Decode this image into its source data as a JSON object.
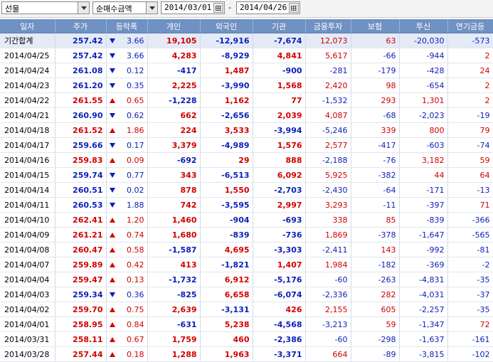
{
  "toolbar": {
    "market_select": "선물",
    "metric_select": "순매수금액",
    "start_date": "2014/03/01",
    "end_date": "2014/04/26",
    "range_separator": "-"
  },
  "columns": [
    "일자",
    "주가",
    "등락폭",
    "개인",
    "외국인",
    "기관",
    "금융투자",
    "보험",
    "투신",
    "연기금등"
  ],
  "rows": [
    {
      "date": "기간합계",
      "price": "257.42",
      "dir": "down",
      "change": "3.66",
      "indiv": "19,105",
      "foreign": "-12,916",
      "inst": "-7,674",
      "fin": "12,073",
      "ins": "63",
      "trust": "-20,030",
      "pension": "-573",
      "total": true
    },
    {
      "date": "2014/04/25",
      "price": "257.42",
      "dir": "down",
      "change": "3.66",
      "indiv": "4,283",
      "foreign": "-8,929",
      "inst": "4,841",
      "fin": "5,617",
      "ins": "-66",
      "trust": "-944",
      "pension": "2"
    },
    {
      "date": "2014/04/24",
      "price": "261.08",
      "dir": "down",
      "change": "0.12",
      "indiv": "-417",
      "foreign": "1,487",
      "inst": "-900",
      "fin": "-281",
      "ins": "-179",
      "trust": "-428",
      "pension": "24"
    },
    {
      "date": "2014/04/23",
      "price": "261.20",
      "dir": "down",
      "change": "0.35",
      "indiv": "2,225",
      "foreign": "-3,990",
      "inst": "1,568",
      "fin": "2,420",
      "ins": "98",
      "trust": "-654",
      "pension": "2"
    },
    {
      "date": "2014/04/22",
      "price": "261.55",
      "dir": "up",
      "change": "0.65",
      "indiv": "-1,228",
      "foreign": "1,162",
      "inst": "77",
      "fin": "-1,532",
      "ins": "293",
      "trust": "1,301",
      "pension": "2"
    },
    {
      "date": "2014/04/21",
      "price": "260.90",
      "dir": "down",
      "change": "0.62",
      "indiv": "662",
      "foreign": "-2,656",
      "inst": "2,039",
      "fin": "4,087",
      "ins": "-68",
      "trust": "-2,023",
      "pension": "-19"
    },
    {
      "date": "2014/04/18",
      "price": "261.52",
      "dir": "up",
      "change": "1.86",
      "indiv": "224",
      "foreign": "3,533",
      "inst": "-3,994",
      "fin": "-5,246",
      "ins": "339",
      "trust": "800",
      "pension": "79"
    },
    {
      "date": "2014/04/17",
      "price": "259.66",
      "dir": "down",
      "change": "0.17",
      "indiv": "3,379",
      "foreign": "-4,989",
      "inst": "1,576",
      "fin": "2,577",
      "ins": "-417",
      "trust": "-603",
      "pension": "-74"
    },
    {
      "date": "2014/04/16",
      "price": "259.83",
      "dir": "up",
      "change": "0.09",
      "indiv": "-692",
      "foreign": "29",
      "inst": "888",
      "fin": "-2,188",
      "ins": "-76",
      "trust": "3,182",
      "pension": "59"
    },
    {
      "date": "2014/04/15",
      "price": "259.74",
      "dir": "down",
      "change": "0.77",
      "indiv": "343",
      "foreign": "-6,513",
      "inst": "6,092",
      "fin": "5,925",
      "ins": "-382",
      "trust": "44",
      "pension": "64"
    },
    {
      "date": "2014/04/14",
      "price": "260.51",
      "dir": "down",
      "change": "0.02",
      "indiv": "878",
      "foreign": "1,550",
      "inst": "-2,703",
      "fin": "-2,430",
      "ins": "-64",
      "trust": "-171",
      "pension": "-13"
    },
    {
      "date": "2014/04/11",
      "price": "260.53",
      "dir": "down",
      "change": "1.88",
      "indiv": "742",
      "foreign": "-3,595",
      "inst": "2,997",
      "fin": "3,293",
      "ins": "-11",
      "trust": "-397",
      "pension": "71"
    },
    {
      "date": "2014/04/10",
      "price": "262.41",
      "dir": "up",
      "change": "1.20",
      "indiv": "1,460",
      "foreign": "-904",
      "inst": "-693",
      "fin": "338",
      "ins": "85",
      "trust": "-839",
      "pension": "-366"
    },
    {
      "date": "2014/04/09",
      "price": "261.21",
      "dir": "up",
      "change": "0.74",
      "indiv": "1,680",
      "foreign": "-839",
      "inst": "-736",
      "fin": "1,869",
      "ins": "-378",
      "trust": "-1,647",
      "pension": "-565"
    },
    {
      "date": "2014/04/08",
      "price": "260.47",
      "dir": "up",
      "change": "0.58",
      "indiv": "-1,587",
      "foreign": "4,695",
      "inst": "-3,303",
      "fin": "-2,411",
      "ins": "143",
      "trust": "-992",
      "pension": "-81"
    },
    {
      "date": "2014/04/07",
      "price": "259.89",
      "dir": "up",
      "change": "0.42",
      "indiv": "413",
      "foreign": "-1,821",
      "inst": "1,407",
      "fin": "1,984",
      "ins": "-182",
      "trust": "-369",
      "pension": "-2"
    },
    {
      "date": "2014/04/04",
      "price": "259.47",
      "dir": "up",
      "change": "0.13",
      "indiv": "-1,732",
      "foreign": "6,912",
      "inst": "-5,176",
      "fin": "-60",
      "ins": "-263",
      "trust": "-4,831",
      "pension": "-35"
    },
    {
      "date": "2014/04/03",
      "price": "259.34",
      "dir": "down",
      "change": "0.36",
      "indiv": "-825",
      "foreign": "6,658",
      "inst": "-6,074",
      "fin": "-2,336",
      "ins": "282",
      "trust": "-4,031",
      "pension": "-37"
    },
    {
      "date": "2014/04/02",
      "price": "259.70",
      "dir": "up",
      "change": "0.75",
      "indiv": "2,639",
      "foreign": "-3,131",
      "inst": "426",
      "fin": "2,155",
      "ins": "605",
      "trust": "-2,257",
      "pension": "-35"
    },
    {
      "date": "2014/04/01",
      "price": "258.95",
      "dir": "up",
      "change": "0.84",
      "indiv": "-631",
      "foreign": "5,238",
      "inst": "-4,568",
      "fin": "-3,213",
      "ins": "59",
      "trust": "-1,347",
      "pension": "72"
    },
    {
      "date": "2014/03/31",
      "price": "258.11",
      "dir": "up",
      "change": "0.67",
      "indiv": "1,759",
      "foreign": "460",
      "inst": "-2,386",
      "fin": "-60",
      "ins": "-298",
      "trust": "-1,637",
      "pension": "-161"
    },
    {
      "date": "2014/03/28",
      "price": "257.44",
      "dir": "up",
      "change": "0.18",
      "indiv": "1,288",
      "foreign": "1,963",
      "inst": "-3,371",
      "fin": "664",
      "ins": "-89",
      "trust": "-3,815",
      "pension": "-102"
    }
  ],
  "colors": {
    "header_bg": "#6f91c3",
    "up": "#d20000",
    "down": "#0a1fb8",
    "total_row_bg": "#e4ebf7"
  }
}
